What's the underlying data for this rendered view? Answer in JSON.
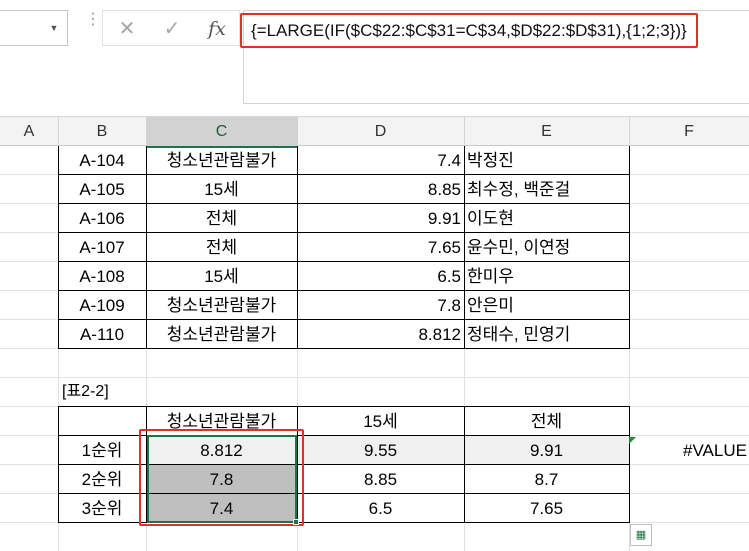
{
  "formula_bar": {
    "name_box_value": "",
    "cancel_icon": "x-icon",
    "enter_icon": "check-icon",
    "function_label": "fx",
    "formula": "{=LARGE(IF($C$22:$C$31=C$34,$D$22:$D$31),{1;2;3})}"
  },
  "columns": [
    "A",
    "B",
    "C",
    "D",
    "E",
    "F"
  ],
  "table1": {
    "rows": [
      {
        "code": "A-104",
        "rating": "청소년관람불가",
        "score": "7.4",
        "names": "박정진"
      },
      {
        "code": "A-105",
        "rating": "15세",
        "score": "8.85",
        "names": "최수정, 백준걸"
      },
      {
        "code": "A-106",
        "rating": "전체",
        "score": "9.91",
        "names": "이도현"
      },
      {
        "code": "A-107",
        "rating": "전체",
        "score": "7.65",
        "names": "윤수민, 이연정"
      },
      {
        "code": "A-108",
        "rating": "15세",
        "score": "6.5",
        "names": "한미우"
      },
      {
        "code": "A-109",
        "rating": "청소년관람불가",
        "score": "7.8",
        "names": "안은미"
      },
      {
        "code": "A-110",
        "rating": "청소년관람불가",
        "score": "8.812",
        "names": "정태수, 민영기"
      }
    ]
  },
  "table2": {
    "label": "[표2-2]",
    "headers": [
      "",
      "청소년관람불가",
      "15세",
      "전체"
    ],
    "rows": [
      {
        "rank": "1순위",
        "c": "8.812",
        "d": "9.55",
        "e": "9.91"
      },
      {
        "rank": "2순위",
        "c": "7.8",
        "d": "8.85",
        "e": "8.7"
      },
      {
        "rank": "3순위",
        "c": "7.4",
        "d": "6.5",
        "e": "7.65"
      }
    ]
  },
  "error_cell": "#VALUE",
  "colors": {
    "selection_green": "#217346",
    "highlight_red": "#e0302a",
    "header_bg": "#f3f3f3",
    "selected_fill": "#bfbfbf",
    "shaded_fill": "#f0f0f0"
  }
}
